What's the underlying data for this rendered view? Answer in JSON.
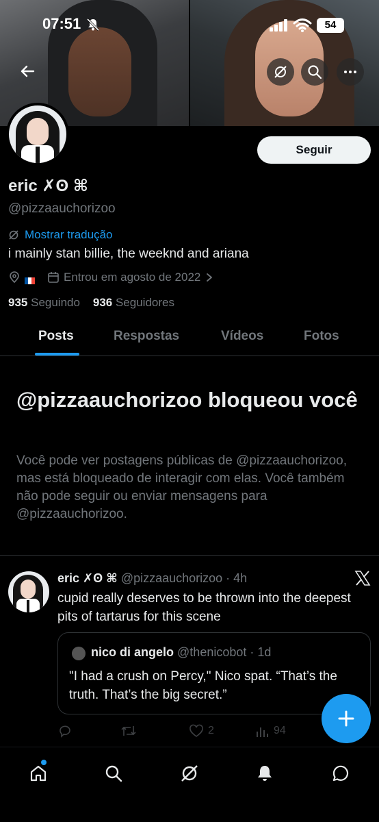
{
  "status_bar": {
    "time": "07:51",
    "battery": "54"
  },
  "profile": {
    "follow_label": "Seguir",
    "name": "eric ✗ʘ ⌘",
    "handle": "@pizzaauchorizoo",
    "translate_label": "Mostrar tradução",
    "bio": "i mainly stan billie, the weeknd and ariana",
    "joined": "Entrou em agosto de 2022",
    "following_count": "935",
    "following_label": "Seguindo",
    "followers_count": "936",
    "followers_label": "Seguidores",
    "flag_colors": [
      "#0055a4",
      "#ffffff",
      "#ef4135"
    ]
  },
  "tabs": [
    "Posts",
    "Respostas",
    "Vídeos",
    "Fotos"
  ],
  "blocked": {
    "title": "@pizzaauchorizoo bloqueou você",
    "text": "Você pode ver postagens públicas de @pizzaauchorizoo, mas está bloqueado de interagir com elas. Você também não pode seguir ou enviar mensagens para @pizzaauchorizoo."
  },
  "tweet": {
    "name": "eric ✗ʘ ⌘",
    "meta": "@pizzaauchorizoo · 4h",
    "text": "cupid really deserves to be thrown into the deepest pits of tartarus for this scene",
    "quote": {
      "name": "nico di angelo",
      "meta": "@thenicobot · 1d",
      "text": "\"I had a crush on Percy,\" Nico spat. “That’s the truth. That’s the big secret.”"
    },
    "likes": "2",
    "views": "94"
  },
  "colors": {
    "accent": "#1d9bf0",
    "muted": "#71767b",
    "text": "#e7e9ea",
    "border": "#2f3336"
  }
}
